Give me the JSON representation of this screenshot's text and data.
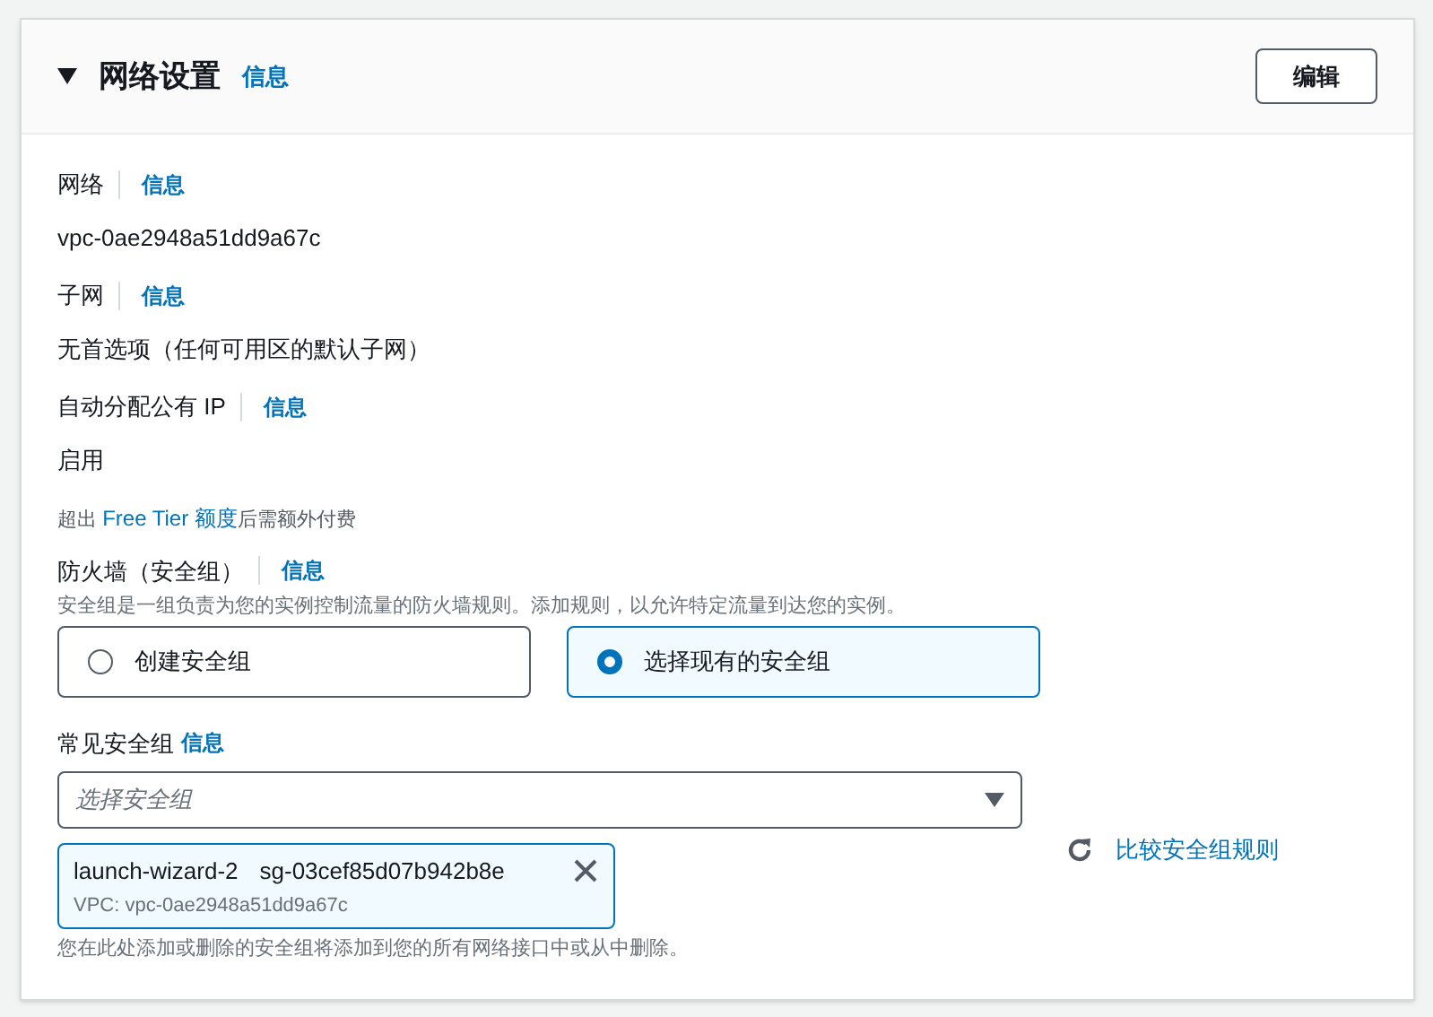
{
  "panel": {
    "title": "网络设置",
    "info": "信息",
    "expanded": true,
    "edit_button": "编辑"
  },
  "fields": [
    {
      "label": "网络",
      "info": "信息",
      "value": "vpc-0ae2948a51dd9a67c"
    },
    {
      "label": "子网",
      "info": "信息",
      "value": "无首选项（任何可用区的默认子网）"
    },
    {
      "label": "自动分配公有 IP",
      "info": "信息",
      "value": "启用"
    }
  ],
  "free_tier_note": {
    "before": "超出 ",
    "link": "Free Tier 额度",
    "after": "后需额外付费"
  },
  "firewall": {
    "label": "防火墙（安全组）",
    "info": "信息",
    "description": "安全组是一组负责为您的实例控制流量的防火墙规则。添加规则，以允许特定流量到达您的实例。",
    "options": [
      {
        "label": "创建安全组",
        "selected": false
      },
      {
        "label": "选择现有的安全组",
        "selected": true
      }
    ]
  },
  "common_groups": {
    "label": "常见安全组",
    "info": "信息",
    "placeholder": "选择安全组",
    "tokens": [
      {
        "name": "launch-wizard-2",
        "id": "sg-03cef85d07b942b8e",
        "vpc": "VPC: vpc-0ae2948a51dd9a67c"
      }
    ],
    "compare_link": "比较安全组规则",
    "hint": "您在此处添加或删除的安全组将添加到您的所有网络接口中或从中删除。"
  }
}
